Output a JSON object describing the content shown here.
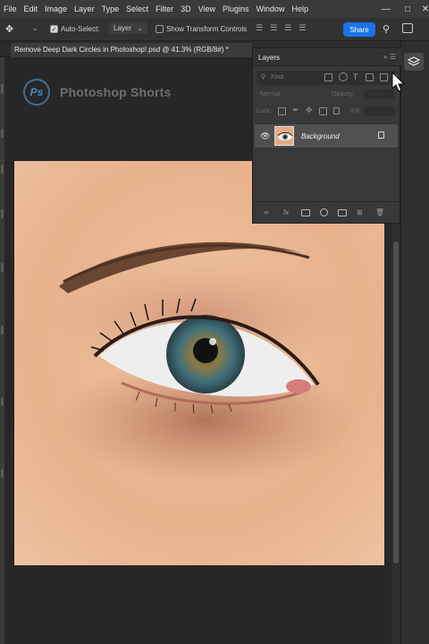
{
  "menubar": {
    "items": [
      "File",
      "Edit",
      "Image",
      "Layer",
      "Type",
      "Select",
      "Filter",
      "3D",
      "View",
      "Plugins",
      "Window",
      "Help"
    ],
    "window_controls": [
      "minimize-icon",
      "restore-icon",
      "close-icon"
    ]
  },
  "options": {
    "auto_select_label": "Auto-Select:",
    "auto_select_value": "Layer",
    "show_transform_label": "Show Transform Controls",
    "share_label": "Share"
  },
  "document": {
    "tab_title": "Remove Deep Dark Circles in Photoshop!.psd @ 41.3% (RGB/8#) *"
  },
  "watermark": {
    "logo_letters": "Ps",
    "brand_text": "Photoshop Shorts"
  },
  "layers_panel": {
    "title": "Layers",
    "kind_placeholder": "Kind",
    "blend_mode": "Normal",
    "opacity_label": "Opacity:",
    "lock_label": "Lock:",
    "fill_label": "Fill:",
    "layers": [
      {
        "name": "Background",
        "visible": true,
        "locked": true
      }
    ],
    "footer_icons": [
      "link-icon",
      "fx-icon",
      "mask-icon",
      "adjustment-icon",
      "folder-icon",
      "new-layer-icon",
      "trash-icon"
    ]
  },
  "colors": {
    "accent": "#1a73e8",
    "panel_bg": "#383838",
    "selected_layer": "#505050"
  }
}
